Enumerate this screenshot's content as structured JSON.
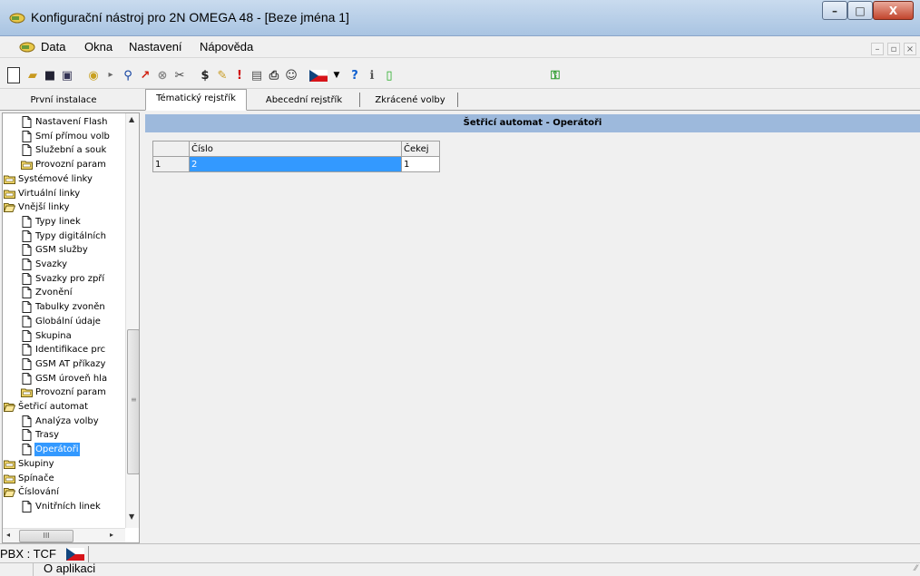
{
  "window": {
    "title": "Konfigurační nástroj pro 2N OMEGA 48 - [Beze jména 1]",
    "min": "–",
    "max": "□",
    "close": "X"
  },
  "menu": [
    {
      "label": "Data"
    },
    {
      "label": "Okna"
    },
    {
      "label": "Nastavení"
    },
    {
      "label": "Nápověda"
    }
  ],
  "mdi": {
    "min": "–",
    "restore": "▫",
    "close": "×"
  },
  "tabs": [
    "První instalace",
    "Tématický rejstřík",
    "Abecední rejstřík",
    "Zkrácené volby"
  ],
  "tree": [
    {
      "label": "Nastavení Flash",
      "type": "doc",
      "level": 1
    },
    {
      "label": "Smí přímou volb",
      "type": "doc",
      "level": 1
    },
    {
      "label": "Služební a souk",
      "type": "doc",
      "level": 1
    },
    {
      "label": "Provozní param",
      "type": "folder",
      "level": 1
    },
    {
      "label": "Systémové linky",
      "type": "folder",
      "level": 0
    },
    {
      "label": "Virtuální linky",
      "type": "folder",
      "level": 0
    },
    {
      "label": "Vnější linky",
      "type": "folder-open",
      "level": 0
    },
    {
      "label": "Typy linek",
      "type": "doc",
      "level": 1
    },
    {
      "label": "Typy digitálních",
      "type": "doc",
      "level": 1
    },
    {
      "label": "GSM služby",
      "type": "doc",
      "level": 1
    },
    {
      "label": "Svazky",
      "type": "doc",
      "level": 1
    },
    {
      "label": "Svazky pro zpří",
      "type": "doc",
      "level": 1
    },
    {
      "label": "Zvonění",
      "type": "doc",
      "level": 1
    },
    {
      "label": "Tabulky zvoněn",
      "type": "doc",
      "level": 1
    },
    {
      "label": "Globální údaje",
      "type": "doc",
      "level": 1
    },
    {
      "label": "Skupina",
      "type": "doc",
      "level": 1
    },
    {
      "label": "Identifikace prc",
      "type": "doc",
      "level": 1
    },
    {
      "label": "GSM AT příkazy",
      "type": "doc",
      "level": 1
    },
    {
      "label": "GSM úroveň hla",
      "type": "doc",
      "level": 1
    },
    {
      "label": "Provozní param",
      "type": "folder",
      "level": 1
    },
    {
      "label": "Šetřicí automat",
      "type": "folder-open",
      "level": 0
    },
    {
      "label": "Analýza volby",
      "type": "doc",
      "level": 1
    },
    {
      "label": "Trasy",
      "type": "doc",
      "level": 1
    },
    {
      "label": "Operátoři",
      "type": "doc",
      "level": 1,
      "selected": true
    },
    {
      "label": "Skupiny",
      "type": "folder",
      "level": 0
    },
    {
      "label": "Spínače",
      "type": "folder",
      "level": 0
    },
    {
      "label": "Číslování",
      "type": "folder-open",
      "level": 0
    },
    {
      "label": "Vnitřních linek",
      "type": "doc",
      "level": 1
    }
  ],
  "panel": {
    "title": "Šetřicí automat - Operátoři",
    "columns": [
      "Číslo",
      "Čekej"
    ],
    "rows": [
      {
        "index": "1",
        "cislo": "2",
        "cekej": "1"
      }
    ]
  },
  "status": {
    "pbx": "PBX : TCF",
    "about": "O aplikaci"
  },
  "scroll": {
    "h_thumb": "III"
  }
}
